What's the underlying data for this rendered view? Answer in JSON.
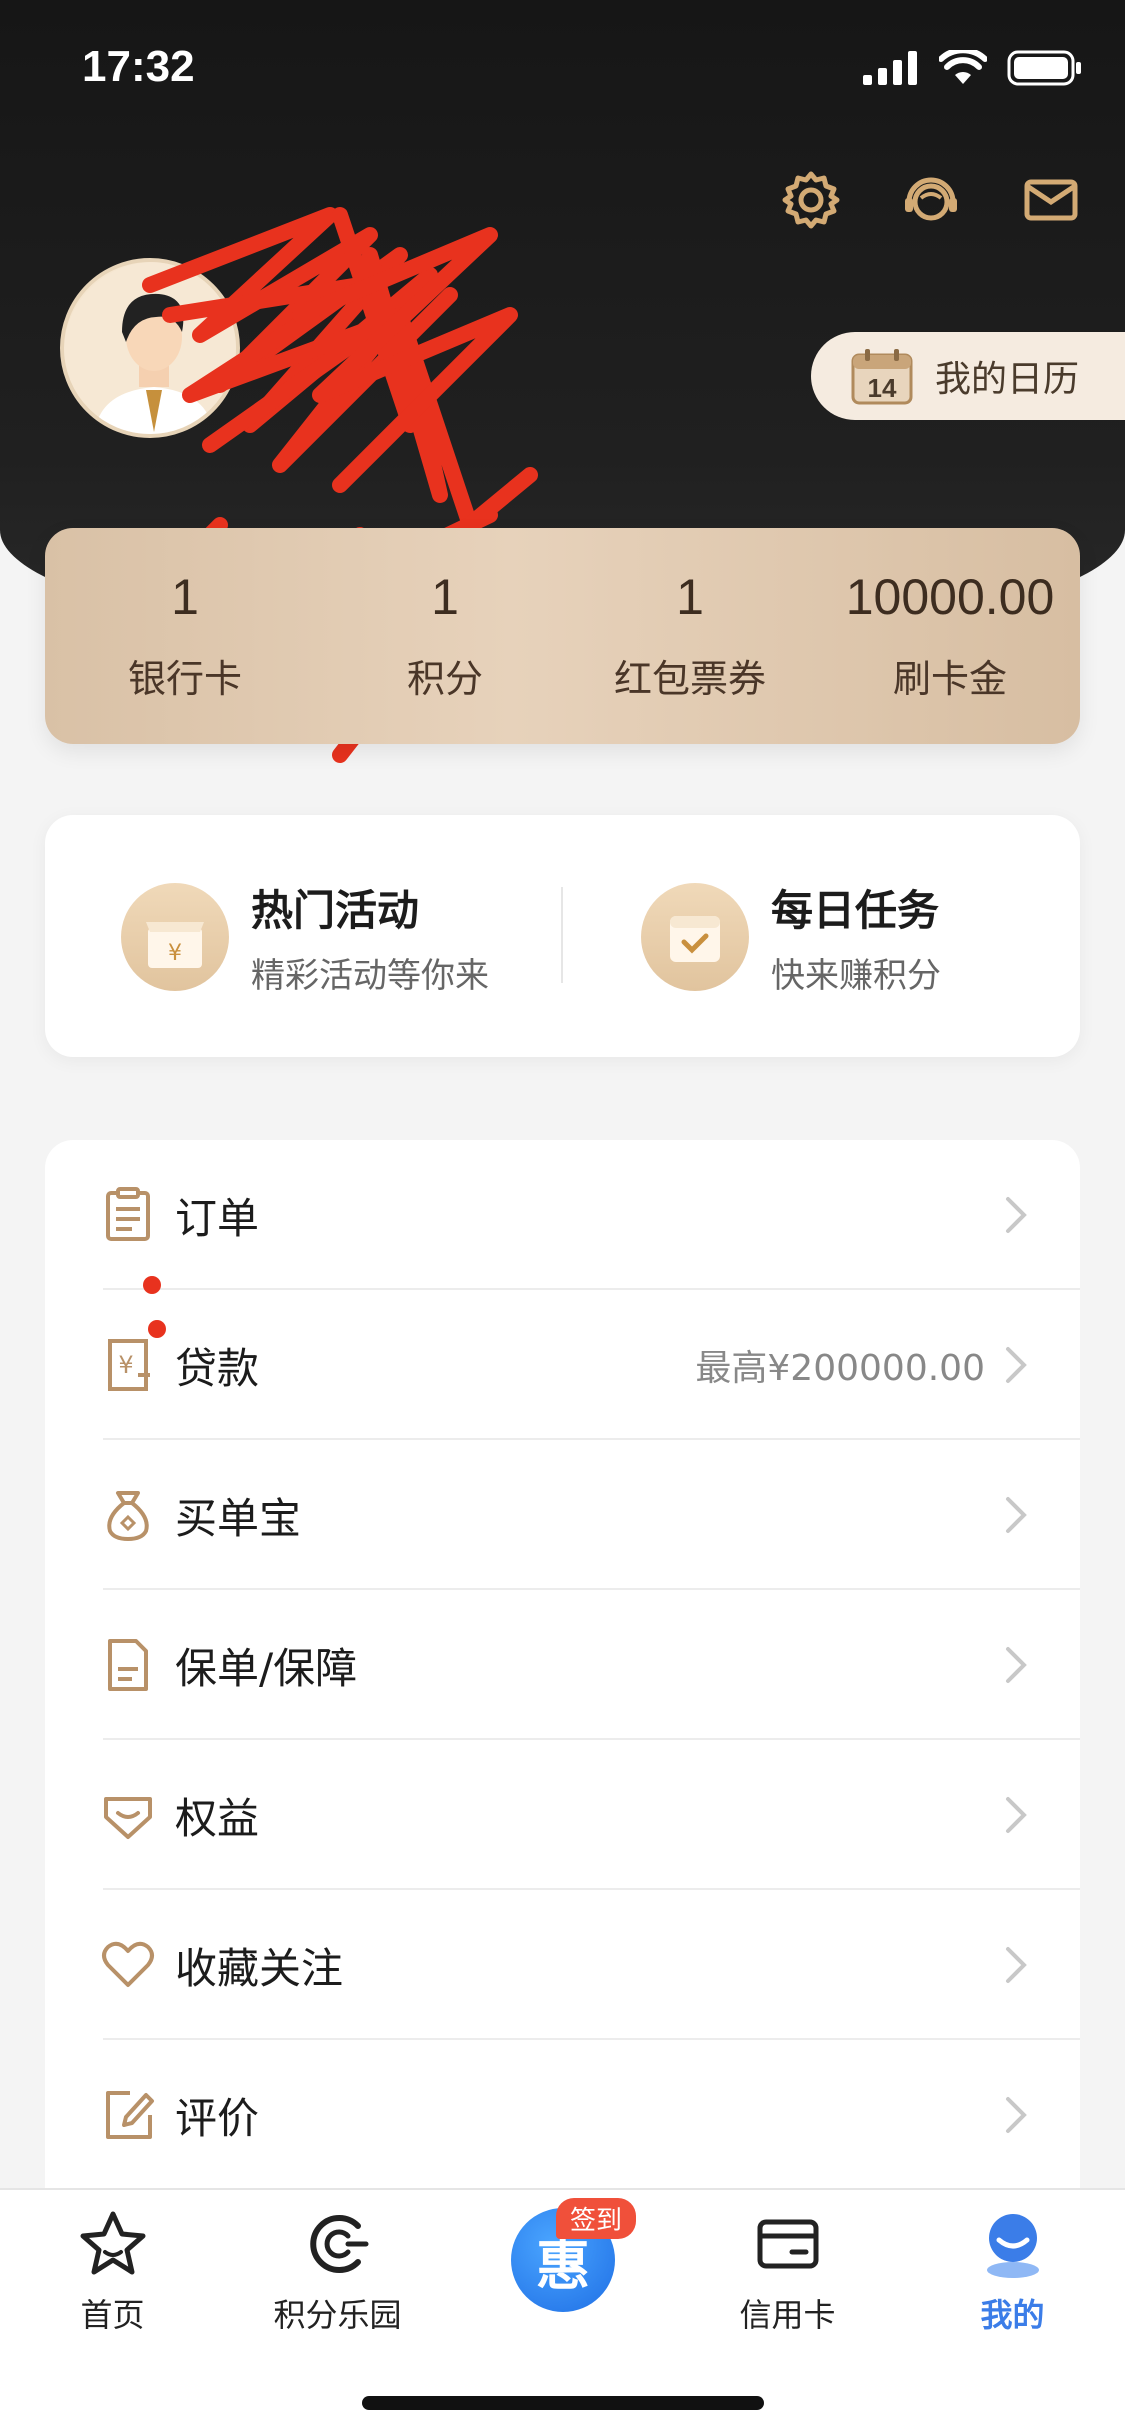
{
  "status_bar": {
    "time": "17:32"
  },
  "header": {
    "calendar_day": "14",
    "calendar_label": "我的日历"
  },
  "stats": [
    {
      "num": "1",
      "label": "银行卡"
    },
    {
      "num": "1",
      "label": "积分"
    },
    {
      "num": "1",
      "label": "红包票券"
    },
    {
      "num": "10000.00",
      "label": "刷卡金"
    }
  ],
  "activities": [
    {
      "title": "热门活动",
      "subtitle": "精彩活动等你来"
    },
    {
      "title": "每日任务",
      "subtitle": "快来赚积分"
    }
  ],
  "menu": [
    {
      "label": "订单",
      "extra": "",
      "icon": "clipboard-icon"
    },
    {
      "label": "贷款",
      "extra": "最高¥200000.00",
      "icon": "yuan-receipt-icon"
    },
    {
      "label": "买单宝",
      "extra": "",
      "icon": "money-bag-icon"
    },
    {
      "label": "保单/保障",
      "extra": "",
      "icon": "document-icon"
    },
    {
      "label": "权益",
      "extra": "",
      "icon": "diamond-tag-icon"
    },
    {
      "label": "收藏关注",
      "extra": "",
      "icon": "heart-icon"
    },
    {
      "label": "评价",
      "extra": "",
      "icon": "edit-icon"
    }
  ],
  "tabbar": {
    "tabs": [
      {
        "label": "首页",
        "icon": "star-icon"
      },
      {
        "label": "积分乐园",
        "icon": "points-c-icon"
      },
      {
        "label": "",
        "icon": "checkin-center-icon"
      },
      {
        "label": "信用卡",
        "icon": "credit-card-icon"
      },
      {
        "label": "我的",
        "icon": "profile-icon"
      }
    ],
    "center_glyph": "惠",
    "center_tag": "签到"
  },
  "colors": {
    "accent_gold": "#c9a57a",
    "active_blue": "#3b7de8",
    "dark_header": "#1a1a1a",
    "scribble_red": "#e8321e"
  }
}
